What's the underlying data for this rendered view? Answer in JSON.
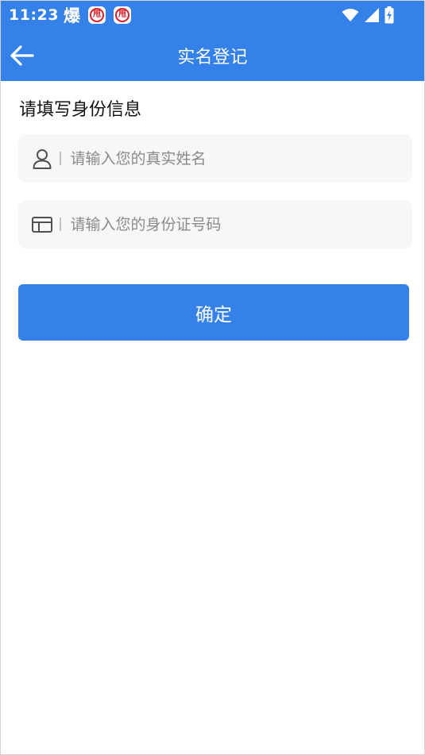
{
  "status_bar": {
    "time": "11:23",
    "glyph": "爆",
    "badge_text": "甩",
    "icons": [
      "wifi-icon",
      "signal-icon",
      "battery-charging-icon"
    ]
  },
  "header": {
    "title": "实名登记",
    "back_icon": "arrow-left-icon"
  },
  "form": {
    "section_title": "请填写身份信息",
    "name_field": {
      "placeholder": "请输入您的真实姓名",
      "value": "",
      "icon": "user-icon"
    },
    "id_field": {
      "placeholder": "请输入您的身份证号码",
      "value": "",
      "icon": "id-card-icon"
    },
    "submit_label": "确定"
  },
  "colors": {
    "brand": "#3381e9",
    "field_bg": "#f7f7f7",
    "placeholder": "#8a8a8a",
    "badge_red": "#d8202b"
  }
}
